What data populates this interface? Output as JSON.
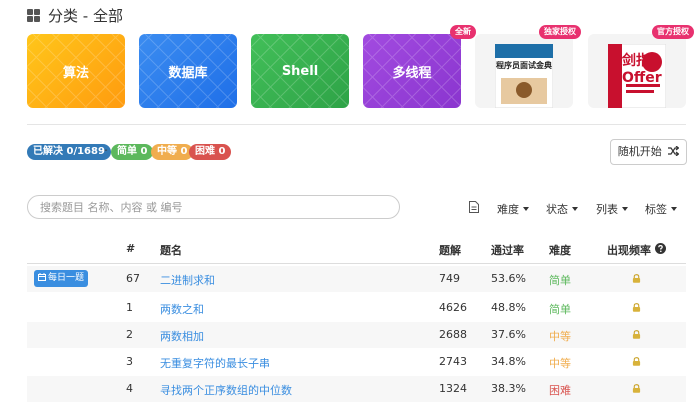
{
  "header": {
    "title": "分类 - 全部"
  },
  "categories": [
    {
      "label": "算法",
      "color_from": "#ffc61a",
      "color_to": "#ff9b0f"
    },
    {
      "label": "数据库",
      "color_from": "#3b8cf0",
      "color_to": "#1f6fe8"
    },
    {
      "label": "Shell",
      "color_from": "#42bf59",
      "color_to": "#2ea347"
    },
    {
      "label": "多线程",
      "color_from": "#a24be0",
      "color_to": "#8a35cf"
    }
  ],
  "books": [
    {
      "badge": "全新",
      "cover_title": "程序员面试金典"
    },
    {
      "badge": "独家授权",
      "cover_title": "程序员面试金典"
    },
    {
      "badge": "官方授权",
      "cover_title": "剑指Offer"
    }
  ],
  "stats": {
    "solved": "已解决 0/1689",
    "separator": "-",
    "easy": "简单 0",
    "medium": "中等 0",
    "hard": "困难 0",
    "solved_color": "#337ab7",
    "easy_color": "#5cb85c",
    "medium_color": "#f0ad4e",
    "hard_color": "#d9534f"
  },
  "random_button": "随机开始",
  "search": {
    "placeholder": "搜索题目 名称、内容 或 编号"
  },
  "filters": [
    "难度",
    "状态",
    "列表",
    "标签"
  ],
  "table": {
    "headers": [
      "#",
      "题名",
      "题解",
      "通过率",
      "难度",
      "出现频率"
    ],
    "daily_label": "每日一题",
    "rows": [
      {
        "id": "67",
        "title": "二进制求和",
        "solutions": "749",
        "rate": "53.6%",
        "difficulty": "简单",
        "level": "easy"
      },
      {
        "id": "1",
        "title": "两数之和",
        "solutions": "4626",
        "rate": "48.8%",
        "difficulty": "简单",
        "level": "easy"
      },
      {
        "id": "2",
        "title": "两数相加",
        "solutions": "2688",
        "rate": "37.6%",
        "difficulty": "中等",
        "level": "medium"
      },
      {
        "id": "3",
        "title": "无重复字符的最长子串",
        "solutions": "2743",
        "rate": "34.8%",
        "difficulty": "中等",
        "level": "medium"
      },
      {
        "id": "4",
        "title": "寻找两个正序数组的中位数",
        "solutions": "1324",
        "rate": "38.3%",
        "difficulty": "困难",
        "level": "hard"
      }
    ]
  }
}
